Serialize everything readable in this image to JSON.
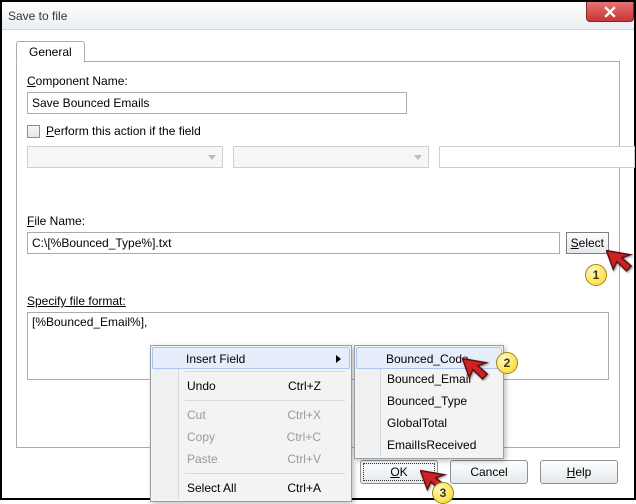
{
  "window": {
    "title": "Save to file"
  },
  "tabs": {
    "general": "General"
  },
  "labels": {
    "component_name": "Component Name:",
    "perform_action": "Perform this action if the field",
    "file_name": "File Name:",
    "specify_format": "Specify file format:"
  },
  "fields": {
    "component_name_value": "Save Bounced Emails",
    "file_name_value": "C:\\[%Bounced_Type%].txt",
    "format_value": "[%Bounced_Email%],"
  },
  "buttons": {
    "select": "Select",
    "ok": "OK",
    "cancel": "Cancel",
    "help": "Help"
  },
  "context_menu": {
    "insert_field": "Insert Field",
    "undo": "Undo",
    "cut": "Cut",
    "copy": "Copy",
    "paste": "Paste",
    "select_all": "Select All",
    "sc_undo": "Ctrl+Z",
    "sc_cut": "Ctrl+X",
    "sc_copy": "Ctrl+C",
    "sc_paste": "Ctrl+V",
    "sc_select_all": "Ctrl+A"
  },
  "submenu": {
    "items": [
      "Bounced_Code",
      "Bounced_Email",
      "Bounced_Type",
      "GlobalTotal",
      "EmailIsReceived"
    ]
  },
  "annotations": {
    "b1": "1",
    "b2": "2",
    "b3": "3"
  }
}
